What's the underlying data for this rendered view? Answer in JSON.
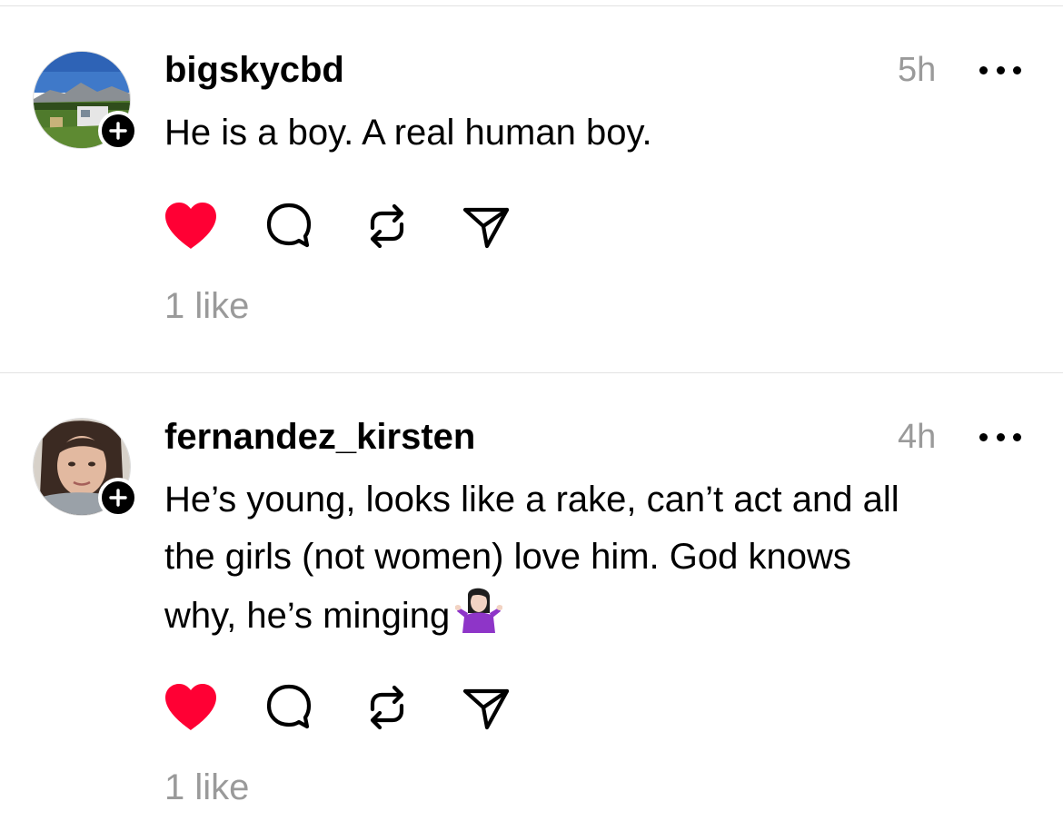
{
  "colors": {
    "like": "#ff0034",
    "muted": "#9a9a9a",
    "divider": "#e2e2e2"
  },
  "posts": [
    {
      "username": "bigskycbd",
      "time": "5h",
      "text": "He is a boy. A real human boy.",
      "likes": "1 like",
      "liked": true
    },
    {
      "username": "fernandez_kirsten",
      "time": "4h",
      "text_lines": [
        "He’s young, looks like a rake, can’t act and all",
        "the girls (not women) love him. God knows",
        "why, he’s minging"
      ],
      "emoji": "person-shrugging-emoji",
      "likes": "1 like",
      "liked": true
    }
  ],
  "icons": {
    "like": "heart-icon",
    "reply": "comment-icon",
    "repost": "repost-icon",
    "share": "send-icon",
    "more": "more-icon",
    "follow": "plus-icon"
  }
}
